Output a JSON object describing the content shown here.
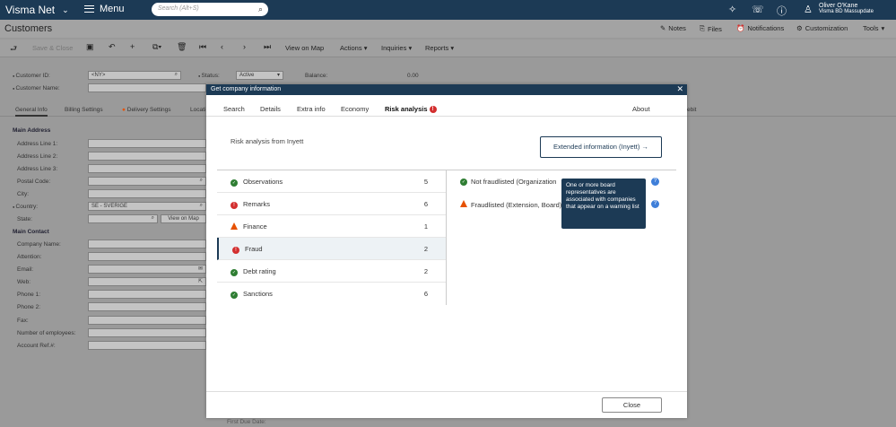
{
  "topbar": {
    "brand": "Visma Net",
    "menu_label": "Menu",
    "search_placeholder": "Search (Alt+S)",
    "user_name": "Oliver O'Kane",
    "user_company": "Visma BD Massupdate"
  },
  "page": {
    "title": "Customers",
    "links": {
      "notes": "Notes",
      "files": "Files",
      "notifications": "Notifications",
      "customization": "Customization",
      "tools": "Tools"
    }
  },
  "toolbar": {
    "save_close": "Save & Close",
    "view_on_map": "View on Map",
    "actions": "Actions",
    "inquiries": "Inquiries",
    "reports": "Reports"
  },
  "form": {
    "customer_id_label": "Customer ID:",
    "customer_id_value": "<NY>",
    "customer_name_label": "Customer Name:",
    "status_label": "Status:",
    "status_value": "Active",
    "balance_label": "Balance:",
    "balance_value": "0.00",
    "tabs": [
      "General Info",
      "Billing Settings",
      "Delivery Settings",
      "Locati",
      "ebit"
    ],
    "main_address": "Main Address",
    "address_fields": [
      "Address Line 1:",
      "Address Line 2:",
      "Address Line 3:",
      "Postal Code:",
      "City:",
      "Country:",
      "State:"
    ],
    "country_value": "SE - SVERIGE",
    "view_on_map": "View on Map",
    "main_contact": "Main Contact",
    "contact_fields": [
      "Company Name:",
      "Attention:",
      "Email:",
      "Web:",
      "Phone 1:",
      "Phone 2:",
      "Fax:",
      "Number of employees:",
      "Account Ref.#:"
    ],
    "first_due_date": "First Due Date:"
  },
  "modal": {
    "title": "Get company information",
    "tabs": [
      "Search",
      "Details",
      "Extra info",
      "Economy",
      "Risk analysis",
      "About"
    ],
    "risk_title": "Risk analysis from Inyett",
    "ext_button": "Extended information (Inyett) →",
    "rows": [
      {
        "name": "Observations",
        "count": "5",
        "status": "ok"
      },
      {
        "name": "Remarks",
        "count": "6",
        "status": "error"
      },
      {
        "name": "Finance",
        "count": "1",
        "status": "warning"
      },
      {
        "name": "Fraud",
        "count": "2",
        "status": "error"
      },
      {
        "name": "Debt rating",
        "count": "2",
        "status": "ok"
      },
      {
        "name": "Sanctions",
        "count": "6",
        "status": "ok"
      }
    ],
    "details": [
      {
        "text": "Not fraudlisted (Organization",
        "status": "ok"
      },
      {
        "text": "Fraudlisted (Extension, Board)",
        "status": "warning"
      }
    ],
    "tooltip": "One or more board representatives are associated with companies that appear on a warning list",
    "close_button": "Close"
  },
  "colors": {
    "navy": "#1c3a55",
    "ok": "#2e7d32",
    "error": "#d32f2f",
    "warning": "#e65100",
    "help": "#3f7fd9"
  }
}
